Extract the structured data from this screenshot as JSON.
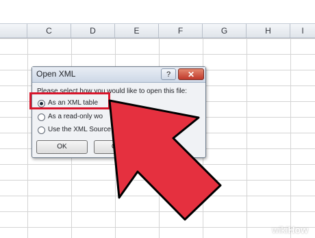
{
  "spreadsheet": {
    "columns": [
      "C",
      "D",
      "E",
      "F",
      "G",
      "H",
      "I"
    ]
  },
  "dialog": {
    "title": "Open XML",
    "help_label": "?",
    "close_label": "✕",
    "prompt": "Please select how you would like to open this file:",
    "options": [
      {
        "label": "As an XML table",
        "checked": true
      },
      {
        "label": "As a read-only wo",
        "checked": false
      },
      {
        "label": "Use the XML Source",
        "checked": false
      }
    ],
    "ok_label": "OK",
    "cancel_label": "Canc"
  },
  "annotation": {
    "highlight_color": "#d8152b",
    "arrow_color": "#e5303f"
  },
  "watermark": {
    "prefix": "wiki",
    "suffix": "How"
  }
}
